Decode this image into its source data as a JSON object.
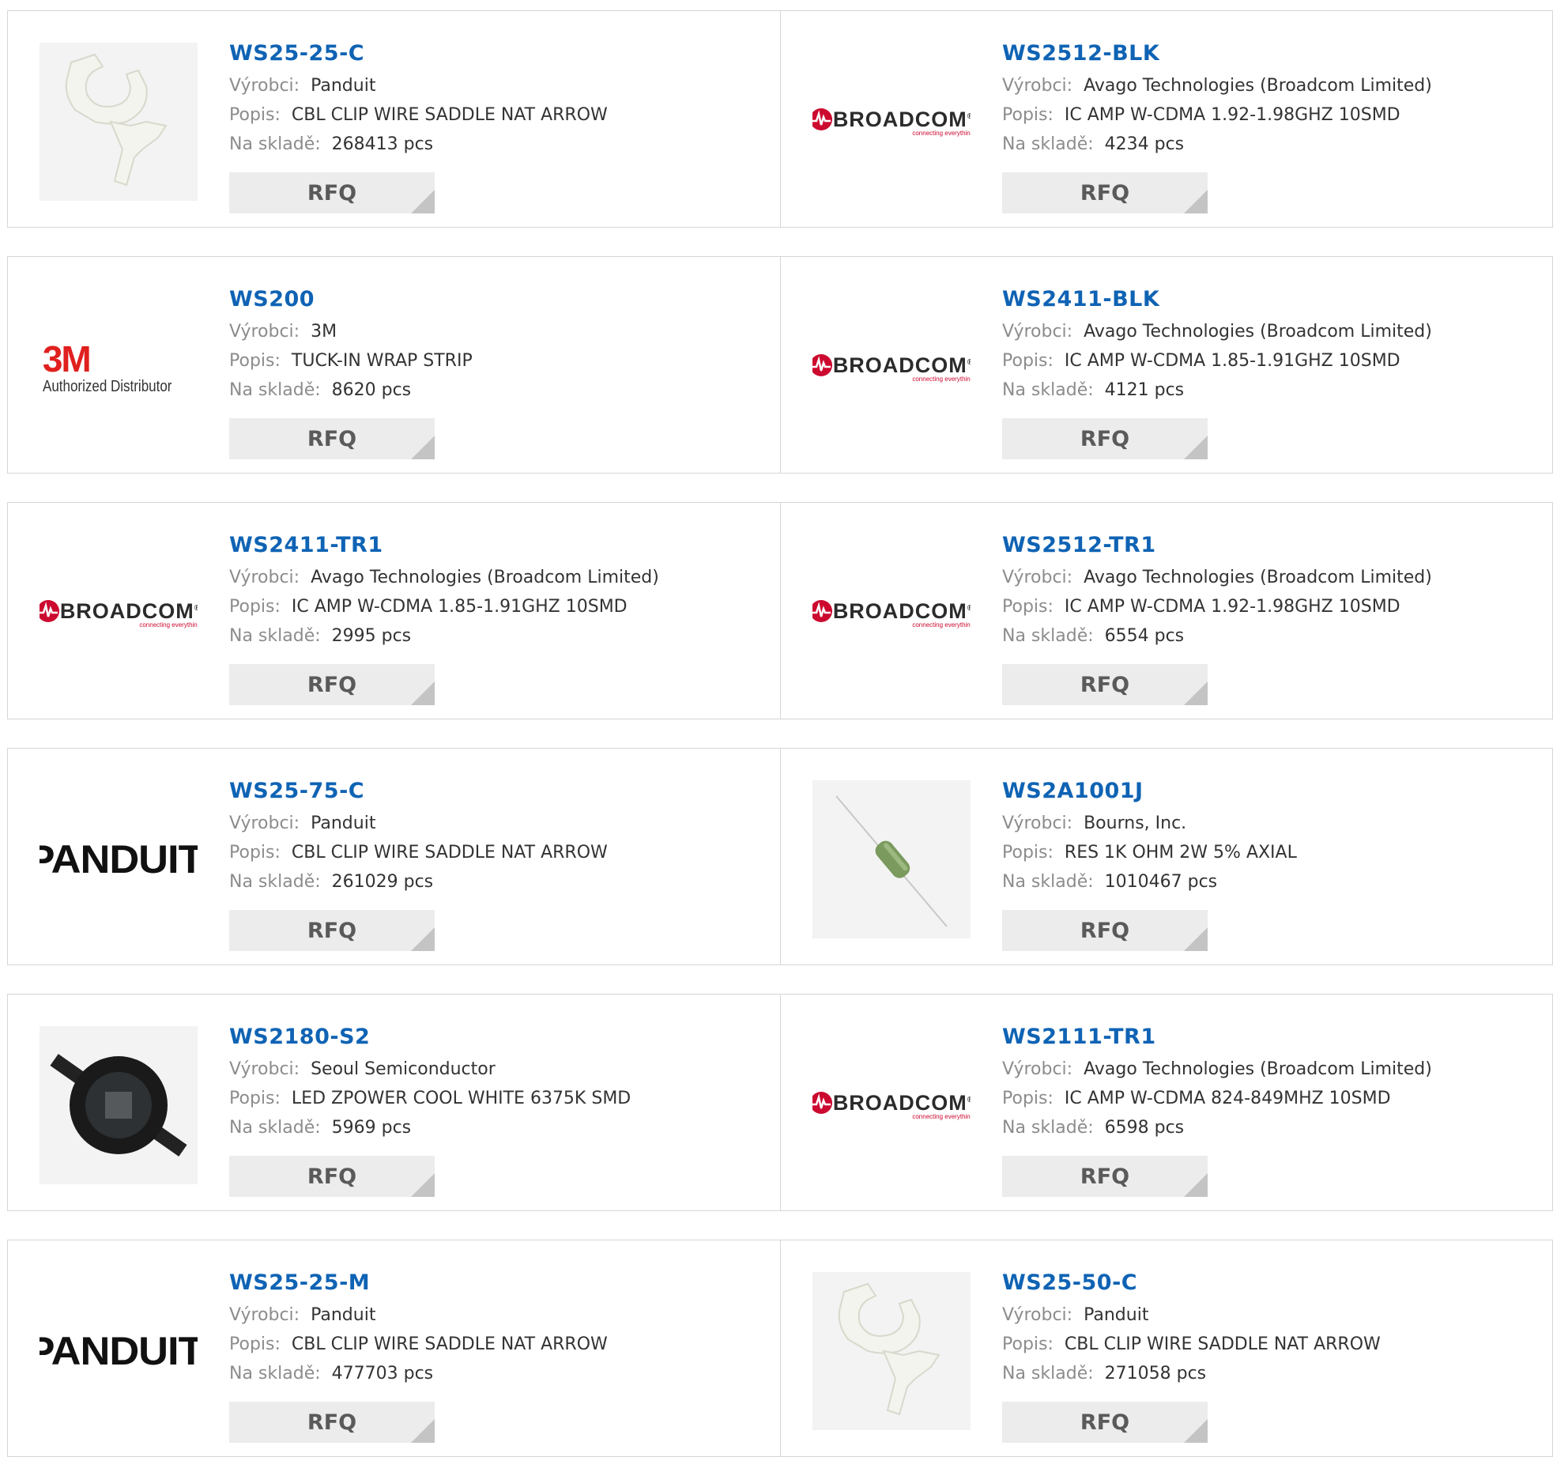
{
  "labels": {
    "manufacturer": "Výrobci:",
    "description": "Popis:",
    "stock": "Na skladě:",
    "rfq": "RFQ",
    "stock_unit": "pcs"
  },
  "products": [
    {
      "pn": "WS25-25-C",
      "manufacturer": "Panduit",
      "description": "CBL CLIP WIRE SADDLE NAT ARROW",
      "stock": "268413 pcs",
      "image": "cable-clip-photo"
    },
    {
      "pn": "WS2512-BLK",
      "manufacturer": "Avago Technologies (Broadcom Limited)",
      "description": "IC AMP W-CDMA 1.92-1.98GHZ 10SMD",
      "stock": "4234 pcs",
      "image": "broadcom-logo"
    },
    {
      "pn": "WS200",
      "manufacturer": "3M",
      "description": "TUCK-IN WRAP STRIP",
      "stock": "8620 pcs",
      "image": "3m-logo"
    },
    {
      "pn": "WS2411-BLK",
      "manufacturer": "Avago Technologies (Broadcom Limited)",
      "description": "IC AMP W-CDMA 1.85-1.91GHZ 10SMD",
      "stock": "4121 pcs",
      "image": "broadcom-logo"
    },
    {
      "pn": "WS2411-TR1",
      "manufacturer": "Avago Technologies (Broadcom Limited)",
      "description": "IC AMP W-CDMA 1.85-1.91GHZ 10SMD",
      "stock": "2995 pcs",
      "image": "broadcom-logo"
    },
    {
      "pn": "WS2512-TR1",
      "manufacturer": "Avago Technologies (Broadcom Limited)",
      "description": "IC AMP W-CDMA 1.92-1.98GHZ 10SMD",
      "stock": "6554 pcs",
      "image": "broadcom-logo"
    },
    {
      "pn": "WS25-75-C",
      "manufacturer": "Panduit",
      "description": "CBL CLIP WIRE SADDLE NAT ARROW",
      "stock": "261029 pcs",
      "image": "panduit-logo"
    },
    {
      "pn": "WS2A1001J",
      "manufacturer": "Bourns, Inc.",
      "description": "RES 1K OHM 2W 5% AXIAL",
      "stock": "1010467 pcs",
      "image": "resistor-photo"
    },
    {
      "pn": "WS2180-S2",
      "manufacturer": "Seoul Semiconductor",
      "description": "LED ZPOWER COOL WHITE 6375K SMD",
      "stock": "5969 pcs",
      "image": "led-photo"
    },
    {
      "pn": "WS2111-TR1",
      "manufacturer": "Avago Technologies (Broadcom Limited)",
      "description": "IC AMP W-CDMA 824-849MHZ 10SMD",
      "stock": "6598 pcs",
      "image": "broadcom-logo"
    },
    {
      "pn": "WS25-25-M",
      "manufacturer": "Panduit",
      "description": "CBL CLIP WIRE SADDLE NAT ARROW",
      "stock": "477703 pcs",
      "image": "panduit-logo"
    },
    {
      "pn": "WS25-50-C",
      "manufacturer": "Panduit",
      "description": "CBL CLIP WIRE SADDLE NAT ARROW",
      "stock": "271058 pcs",
      "image": "cable-clip-photo"
    }
  ],
  "logos": {
    "broadcom": {
      "name": "BROADCOM",
      "mark": "®",
      "tagline": "connecting everything"
    },
    "3m": {
      "name": "3M",
      "subtitle": "Authorized Distributor"
    },
    "panduit": {
      "name": "PANDUIT",
      "mark": "®"
    }
  },
  "colors": {
    "link": "#0f63b4",
    "label": "#8c8c8c",
    "border": "#d6d6d6",
    "button_bg": "#ececec",
    "broadcom_red": "#cc092f",
    "3m_red": "#e0201f"
  }
}
